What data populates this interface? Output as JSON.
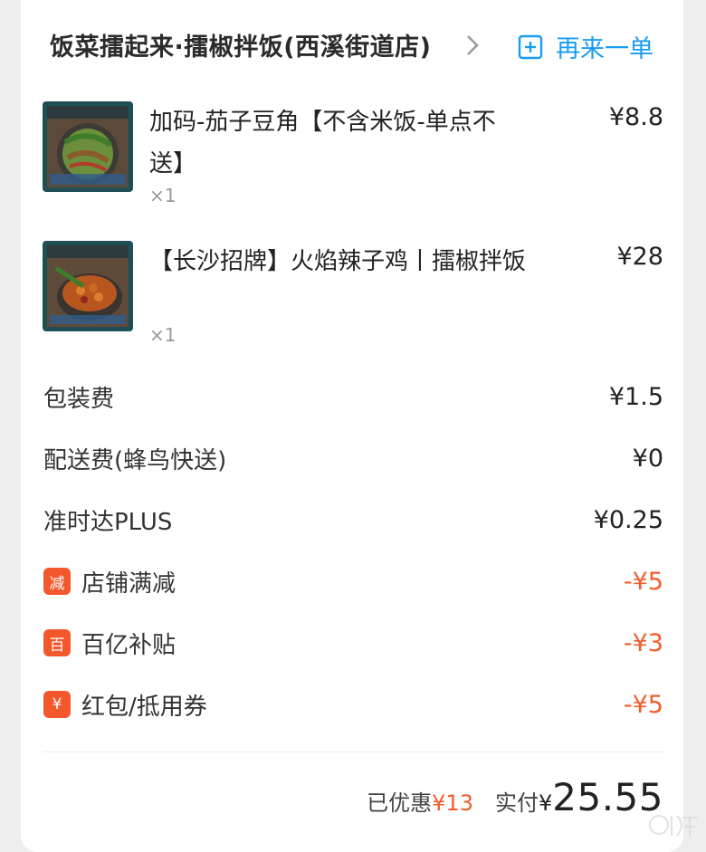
{
  "header": {
    "shop_name": "饭菜擂起来·擂椒拌饭(西溪街道店)",
    "reorder_label": "再来一单"
  },
  "items": [
    {
      "name": "加码-茄子豆角【不含米饭-单点不送】",
      "qty": "×1",
      "price": "¥8.8"
    },
    {
      "name": "【长沙招牌】火焰辣子鸡丨擂椒拌饭",
      "qty": "×1",
      "price": "¥28"
    }
  ],
  "fees": [
    {
      "label": "包装费",
      "value": "¥1.5"
    },
    {
      "label": "配送费(蜂鸟快送)",
      "value": "¥0"
    },
    {
      "label": "准时达PLUS",
      "value": "¥0.25"
    }
  ],
  "discounts": [
    {
      "tag": "减",
      "label": "店铺满减",
      "value": "-¥5"
    },
    {
      "tag": "百",
      "label": "百亿补贴",
      "value": "-¥3"
    },
    {
      "tag": "¥",
      "label": "红包/抵用券",
      "value": "-¥5"
    }
  ],
  "summary": {
    "discount_label": "已优惠",
    "discount_value": "¥13",
    "paid_label": "实付",
    "currency": "¥",
    "paid_value": "25.55"
  },
  "colors": {
    "accent_blue": "#1a9cf2",
    "discount_red": "#f25c2a",
    "tag_red": "#f3572c"
  }
}
